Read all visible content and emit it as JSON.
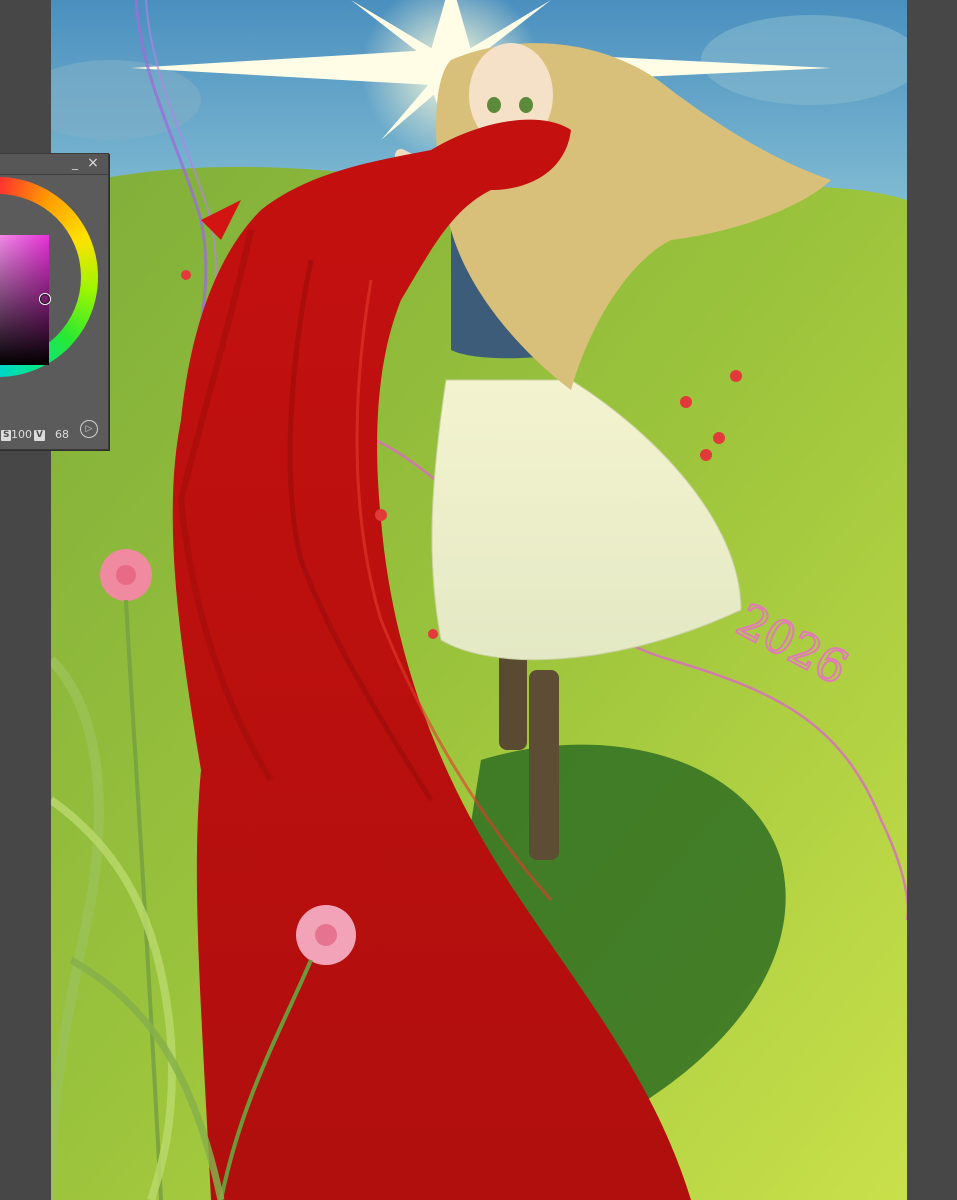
{
  "window": {
    "app_background": "#474747",
    "canvas_background": "#8bbf3a"
  },
  "canvas": {
    "artwork_text": "2026",
    "artwork_text_color": "#e27ab8"
  },
  "color_wheel_panel": {
    "minimize_icon": "minimize-icon",
    "close_icon": "close-icon",
    "minimize_glyph": "_",
    "close_glyph": "×",
    "current_color": "#c23aa8",
    "s_label": "S",
    "s_value": "100",
    "v_label": "V",
    "v_value": "68",
    "switch_icon": "play-circle-icon",
    "switch_glyph": "▷"
  }
}
